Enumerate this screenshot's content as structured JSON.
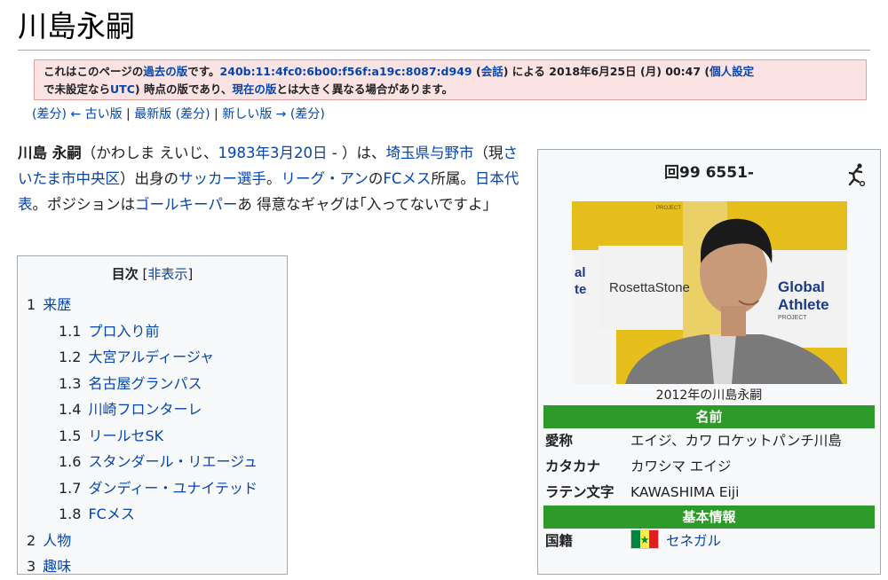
{
  "page": {
    "title": "川島永嗣"
  },
  "revision": {
    "line1": {
      "prefix": "これはこのページの",
      "old_link": "過去の版",
      "mid1": "です。",
      "user": "240b:11:4fc0:6b00:f56f:a19c:8087:d949",
      "talk_open": " (",
      "talk": "会話",
      "talk_close": ") による 2018年6月25日 (月) 00:47 (",
      "prefs": "個人設定"
    },
    "line2": {
      "prefix": "で未設定なら",
      "utc": "UTC",
      "mid": ") 時点の版であり、",
      "current": "現在の版",
      "suffix": "とは大きく異なる場合があります。"
    }
  },
  "revnav": {
    "diff1": "(差分)",
    "older": "← 古い版",
    "sep1": " | ",
    "latest": "最新版",
    "diff2": "(差分)",
    "sep2": " | ",
    "newer": "新しい版 →",
    "diff3": "(差分)"
  },
  "intro": {
    "name": "川島 永嗣",
    "reading": "（かわしま えいじ、",
    "birthdate": "1983年3月20日",
    "dash": " - ）は、",
    "birthplace": "埼玉県与野市",
    "now_open": "（現",
    "now_place": "さいたま市中央区",
    "now_close": "）出身の",
    "job": "サッカー選手",
    "sep": "。",
    "league": "リーグ・アン",
    "no": "の",
    "club": "FCメス",
    "belong": "所属。",
    "national": "日本代表",
    "pos_prefix": "。ポジションは",
    "position": "ゴールキーパー",
    "tail": "あ 得意なギャグは｢入ってないですよ｣"
  },
  "toc": {
    "title": "目次",
    "toggle_open": "[",
    "toggle": "非表示",
    "toggle_close": "]",
    "items": [
      {
        "num": "1",
        "label": "来歴",
        "level": 1
      },
      {
        "num": "1.1",
        "label": "プロ入り前",
        "level": 2
      },
      {
        "num": "1.2",
        "label": "大宮アルディージャ",
        "level": 2
      },
      {
        "num": "1.3",
        "label": "名古屋グランパス",
        "level": 2
      },
      {
        "num": "1.4",
        "label": "川崎フロンターレ",
        "level": 2
      },
      {
        "num": "1.5",
        "label": "リールセSK",
        "level": 2
      },
      {
        "num": "1.6",
        "label": "スタンダール・リエージュ",
        "level": 2
      },
      {
        "num": "1.7",
        "label": "ダンディー・ユナイテッド",
        "level": 2
      },
      {
        "num": "1.8",
        "label": "FCメス",
        "level": 2
      },
      {
        "num": "2",
        "label": "人物",
        "level": 1
      },
      {
        "num": "3",
        "label": "趣味",
        "level": 1
      }
    ]
  },
  "infobox": {
    "title": "回99 6551-",
    "photo_text": {
      "sponsor_left": "RosettaStone",
      "project_top": "PROJECT",
      "global": "Global",
      "athlete": "Athlete",
      "project": "PROJECT",
      "al": "al",
      "te": "te"
    },
    "caption": "2012年の川島永嗣",
    "sections": {
      "name": "名前",
      "basic": "基本情報"
    },
    "rows_name": [
      {
        "key": "愛称",
        "value": "エイジ、カワ ロケットパンチ川島"
      },
      {
        "key": "カタカナ",
        "value": "カワシマ エイジ"
      },
      {
        "key": "ラテン文字",
        "value": "KAWASHIMA Eiji"
      }
    ],
    "nationality": {
      "key": "国籍",
      "value": "セネガル"
    },
    "colors": {
      "section_green": "#2e9a2a",
      "flag_green": "#00853f",
      "flag_yellow": "#fdef42",
      "flag_red": "#e31b23",
      "link": "#0645ad"
    },
    "icons": [
      "soccer-player-icon",
      "senegal-flag-icon"
    ]
  }
}
